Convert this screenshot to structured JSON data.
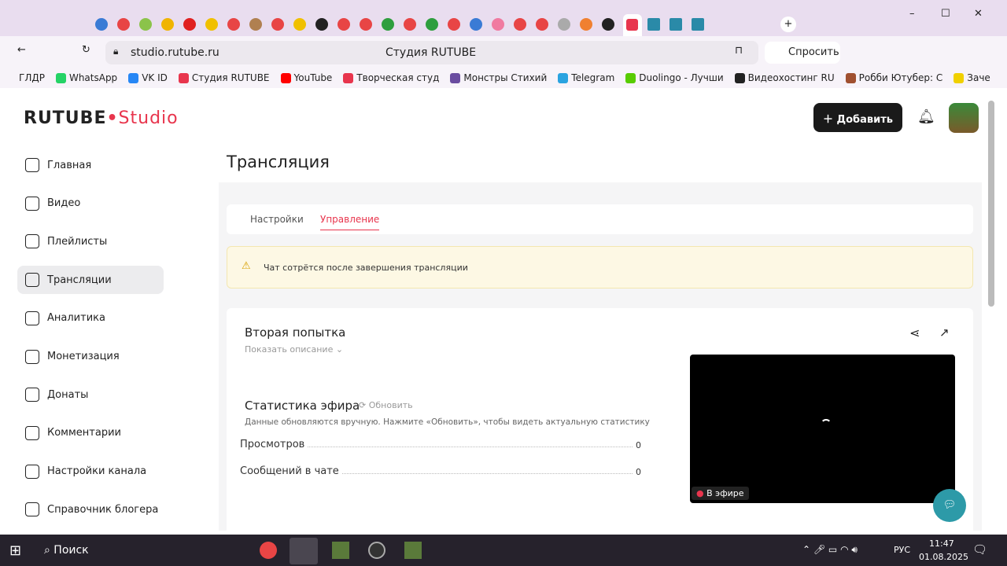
{
  "browser": {
    "page_title": "Студия RUTUBE",
    "url": "studio.rutube.ru",
    "ask_label": "Спросить",
    "bookmarks": [
      "ГЛДР",
      "WhatsApp",
      "VK ID",
      "Студия RUTUBE",
      "YouTube",
      "Творческая студ",
      "Монстры Стихий",
      "Telegram",
      "Duolingo - Лучши",
      "Видеохостинг RU",
      "Робби Ютубер: С",
      "Заче"
    ]
  },
  "header": {
    "logo": "RUTUBE",
    "logo_suffix": "Studio",
    "add_label": "Добавить"
  },
  "sidebar": {
    "items": [
      {
        "label": "Главная"
      },
      {
        "label": "Видео"
      },
      {
        "label": "Плейлисты"
      },
      {
        "label": "Трансляции",
        "active": true
      },
      {
        "label": "Аналитика"
      },
      {
        "label": "Монетизация"
      },
      {
        "label": "Донаты"
      },
      {
        "label": "Комментарии"
      },
      {
        "label": "Настройки канала"
      },
      {
        "label": "Справочник блогера"
      }
    ]
  },
  "main": {
    "title": "Трансляция",
    "tabs": [
      {
        "label": "Настройки"
      },
      {
        "label": "Управление",
        "active": true
      }
    ],
    "warning": "Чат сотрётся после завершения трансляции",
    "stream": {
      "name": "Вторая попытка",
      "show_desc": "Показать описание",
      "live_badge": "В эфире"
    },
    "stats": {
      "title": "Статистика эфира",
      "refresh": "Обновить",
      "note": "Данные обновляются вручную. Нажмите «Обновить», чтобы видеть актуальную статистику",
      "rows": [
        {
          "label": "Просмотров",
          "value": "0"
        },
        {
          "label": "Сообщений в чате",
          "value": "0"
        }
      ]
    }
  },
  "taskbar": {
    "search": "Поиск",
    "lang": "РУС",
    "time": "11:47",
    "date": "01.08.2025"
  },
  "colors": {
    "accent": "#e8354d",
    "warning_bg": "#fdf8e4"
  }
}
